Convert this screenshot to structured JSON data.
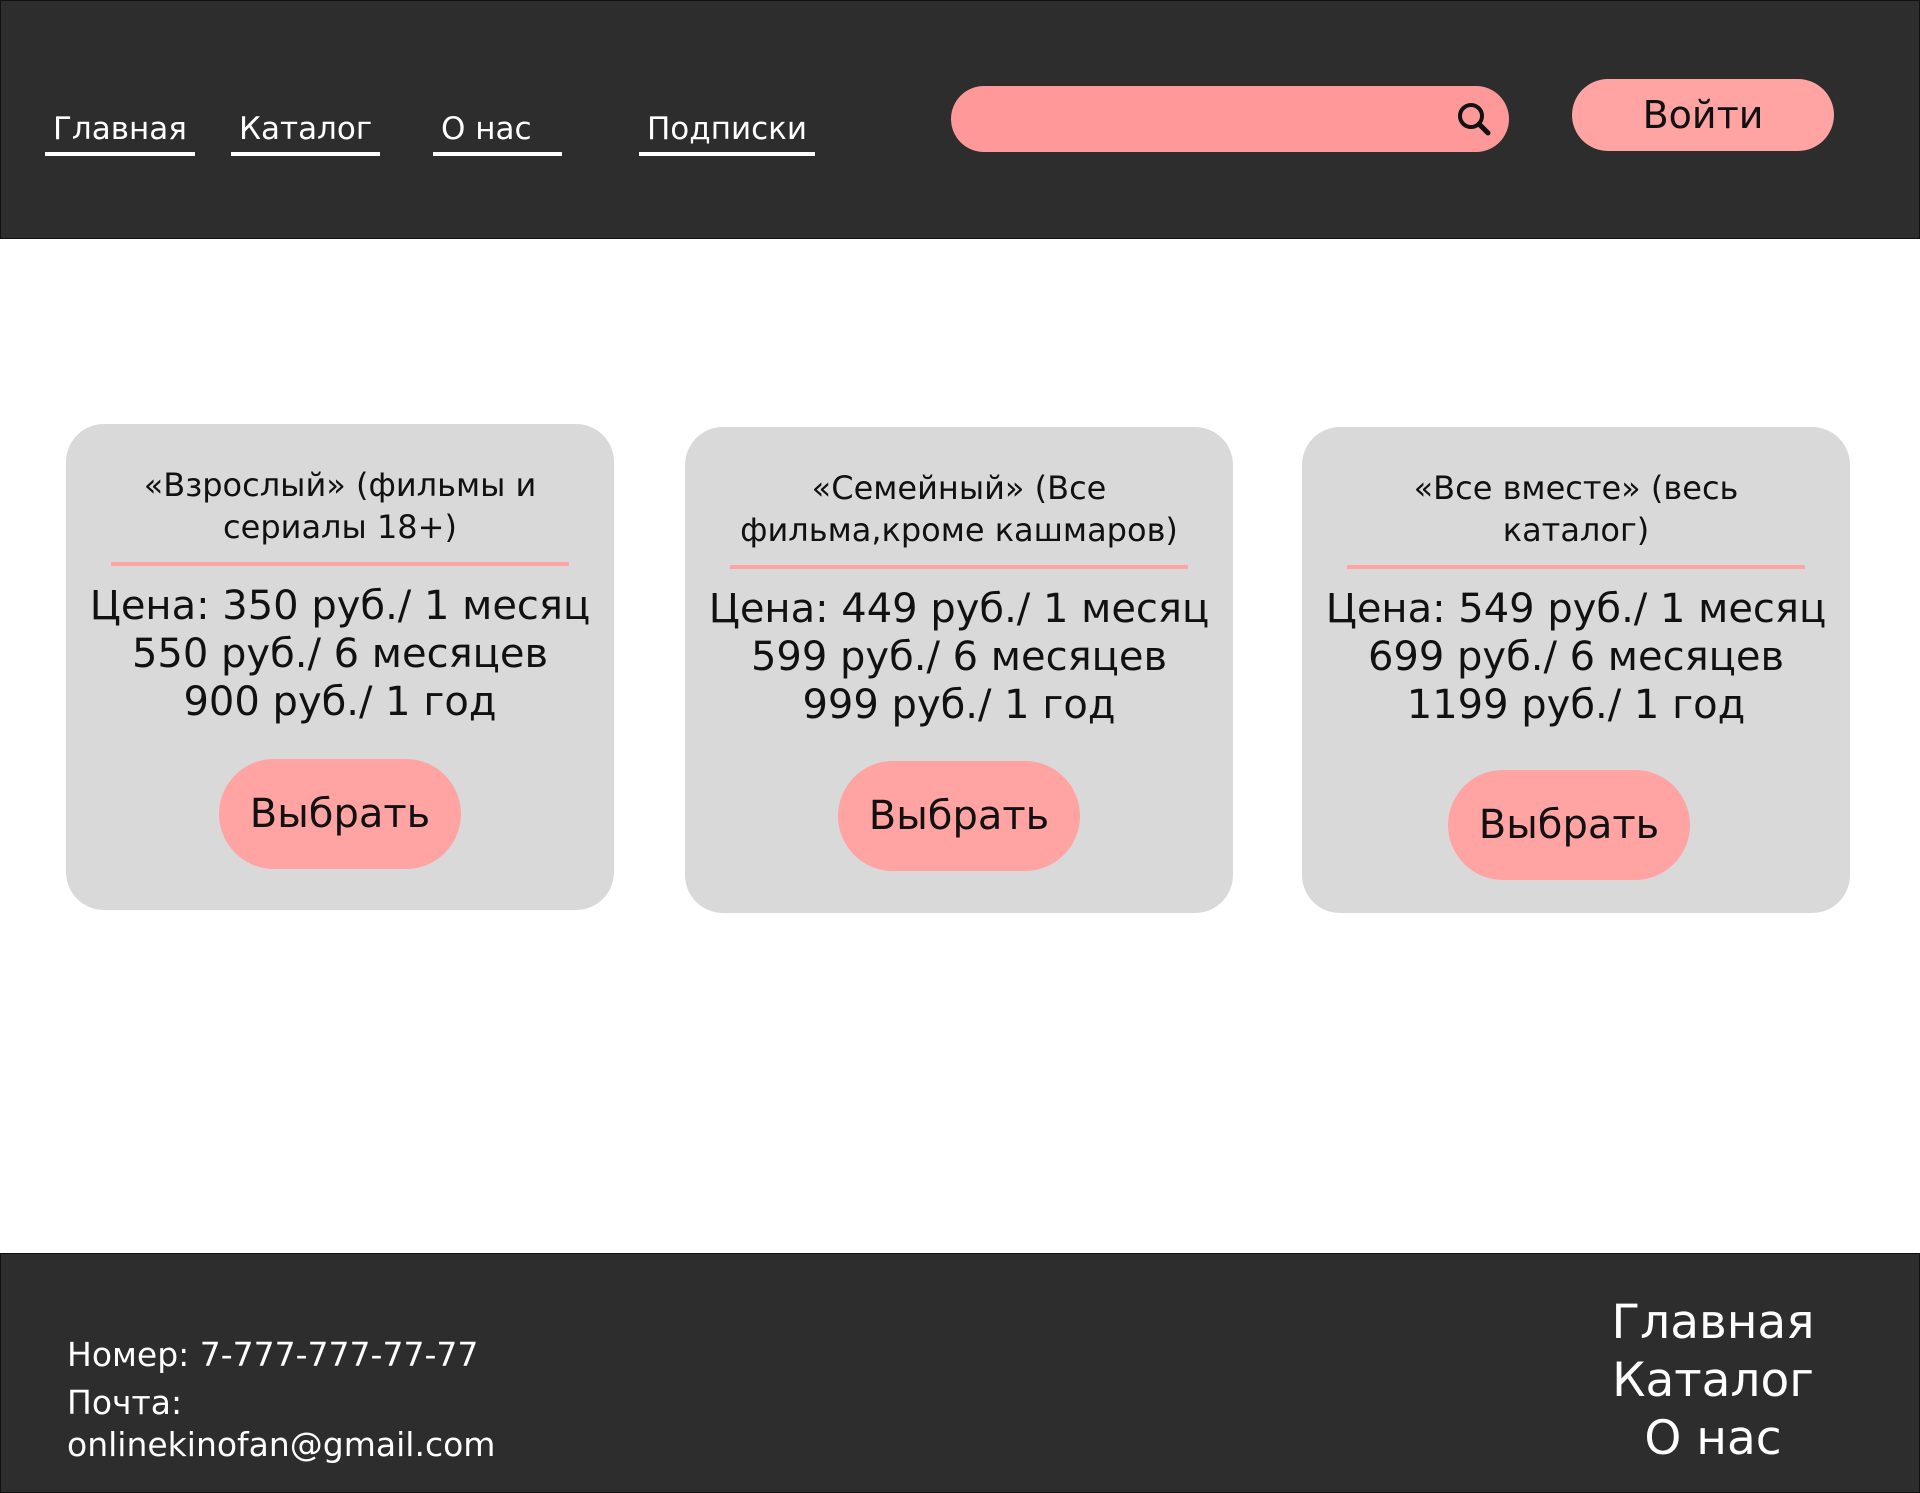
{
  "header": {
    "nav": [
      "Главная",
      "Каталог",
      "О нас",
      "Подписки"
    ],
    "search": {
      "value": "",
      "placeholder": ""
    },
    "login_label": "Войти"
  },
  "plans": [
    {
      "title_line1": "«Взрослый» (фильмы и",
      "title_line2": "сериалы 18+)",
      "price_line1": "Цена: 350 руб./ 1 месяц",
      "price_line2": "550 руб./ 6 месяцев",
      "price_line3": "900 руб./ 1 год",
      "button": "Выбрать"
    },
    {
      "title_line1": "«Семейный» (Все",
      "title_line2": "фильма,кроме кашмаров)",
      "price_line1": "Цена: 449 руб./ 1 месяц",
      "price_line2": "599 руб./ 6 месяцев",
      "price_line3": "999 руб./ 1 год",
      "button": "Выбрать"
    },
    {
      "title_line1": "«Все вместе» (весь",
      "title_line2": "каталог)",
      "price_line1": "Цена: 549 руб./ 1 месяц",
      "price_line2": "699 руб./ 6 месяцев",
      "price_line3": "1199 руб./ 1 год",
      "button": "Выбрать"
    }
  ],
  "footer": {
    "phone": "Номер: 7-777-777-77-77",
    "email_label": "Почта:",
    "email": "onlinekinofan@gmail.com",
    "nav": [
      "Главная",
      "Каталог",
      "О нас"
    ]
  },
  "colors": {
    "dark": "#2d2d2d",
    "accent": "#ffa3a3",
    "search_bg": "#ff9999",
    "card_bg": "#d9d9d9"
  },
  "icons": {
    "search": "search-icon"
  }
}
